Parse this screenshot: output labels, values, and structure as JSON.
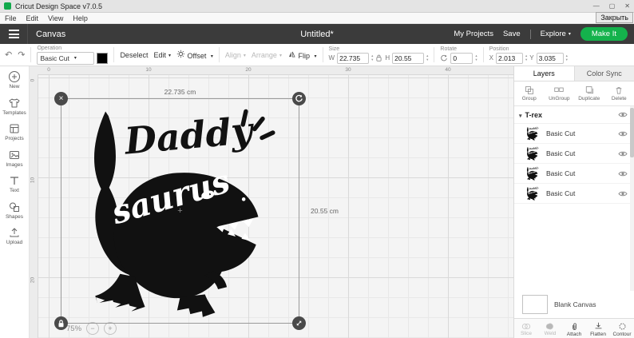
{
  "window": {
    "title": "Cricut Design Space  v7.0.5",
    "menu": [
      "File",
      "Edit",
      "View",
      "Help"
    ],
    "controls": {
      "minimize": "—",
      "maximize": "▢",
      "close": "✕"
    },
    "close_tooltip": "Закрыть"
  },
  "header": {
    "canvas_label": "Canvas",
    "doc_title": "Untitled*",
    "my_projects_label": "My Projects",
    "save_label": "Save",
    "explore_label": "Explore",
    "make_it_label": "Make It"
  },
  "toolbar": {
    "operation_label": "Operation",
    "operation_value": "Basic Cut",
    "deselect_label": "Deselect",
    "edit_label": "Edit",
    "offset_label": "Offset",
    "align_label": "Align",
    "arrange_label": "Arrange",
    "flip_label": "Flip",
    "size_label": "Size",
    "w_label": "W",
    "w_value": "22.735",
    "h_label": "H",
    "h_value": "20.55",
    "rotate_label": "Rotate",
    "rotate_value": "0",
    "position_label": "Position",
    "x_label": "X",
    "x_value": "2.013",
    "y_label": "Y",
    "y_value": "3.035"
  },
  "sidebar": {
    "items": [
      {
        "label": "New"
      },
      {
        "label": "Templates"
      },
      {
        "label": "Projects"
      },
      {
        "label": "Images"
      },
      {
        "label": "Text"
      },
      {
        "label": "Shapes"
      },
      {
        "label": "Upload"
      }
    ]
  },
  "canvas": {
    "ruler_h": [
      "0",
      "10",
      "20",
      "30",
      "40"
    ],
    "ruler_v": [
      "0",
      "10",
      "20"
    ],
    "selection": {
      "width_label": "22.735 cm",
      "height_label": "20.55 cm"
    },
    "design": {
      "line1": "Daddy",
      "line2": "saurus"
    },
    "zoom_level": "75%"
  },
  "layers_panel": {
    "tabs": [
      {
        "label": "Layers"
      },
      {
        "label": "Color Sync"
      }
    ],
    "actions": [
      {
        "label": "Group"
      },
      {
        "label": "UnGroup"
      },
      {
        "label": "Duplicate"
      },
      {
        "label": "Delete"
      }
    ],
    "group": {
      "name": "T-rex"
    },
    "layers": [
      {
        "label": "Basic Cut"
      },
      {
        "label": "Basic Cut"
      },
      {
        "label": "Basic Cut"
      },
      {
        "label": "Basic Cut"
      }
    ],
    "blank_canvas_label": "Blank Canvas",
    "bottom_actions": [
      {
        "label": "Slice"
      },
      {
        "label": "Weld"
      },
      {
        "label": "Attach"
      },
      {
        "label": "Flatten"
      },
      {
        "label": "Contour"
      }
    ]
  },
  "icons": {
    "undo": "↶",
    "redo": "↷",
    "center_cross": "+",
    "zoom_in": "+",
    "zoom_out": "−"
  },
  "colors": {
    "header_bg": "#3b3b3b",
    "make_it_green": "#14b24c",
    "selection_handle": "#4a4a4a",
    "design_fill": "#111111"
  }
}
